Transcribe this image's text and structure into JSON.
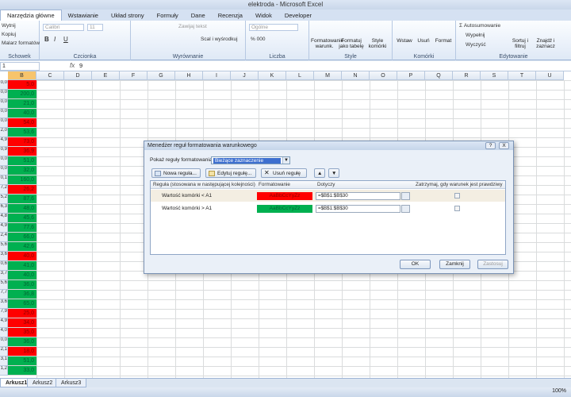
{
  "window": {
    "title": "elektroda - Microsoft Excel"
  },
  "ribbon_tabs": [
    "Narzędzia główne",
    "Wstawianie",
    "Układ strony",
    "Formuły",
    "Dane",
    "Recenzja",
    "Widok",
    "Developer"
  ],
  "ribbon": {
    "clipboard": {
      "items": [
        "Wytnij",
        "Kopiuj",
        "Malarz formatów"
      ],
      "label": "Schowek"
    },
    "font": {
      "name": "Calibri",
      "size": "11",
      "label": "Czcionka"
    },
    "alignment": {
      "wrap": "Zawijaj tekst",
      "merge": "Scal i wyśrodkuj",
      "label": "Wyrównanie"
    },
    "number": {
      "format": "Ogólne",
      "label": "Liczba"
    },
    "styles": {
      "cond": "Formatowanie warunk.",
      "table": "Formatuj jako tabelę",
      "cell": "Style komórki",
      "label": "Style"
    },
    "cells": {
      "insert": "Wstaw",
      "delete": "Usuń",
      "format": "Format",
      "label": "Komórki"
    },
    "editing": {
      "autosum": "Autosumowanie",
      "fill": "Wypełnij",
      "clear": "Wyczyść",
      "sort": "Sortuj i filtruj",
      "find": "Znajdź i zaznacz",
      "label": "Edytowanie"
    }
  },
  "formula_bar": {
    "name_box": "1",
    "fx": "fx",
    "value": "9"
  },
  "columns": [
    "B",
    "C",
    "D",
    "E",
    "F",
    "G",
    "H",
    "I",
    "J",
    "K",
    "L",
    "M",
    "N",
    "O",
    "P",
    "Q",
    "R",
    "S",
    "T",
    "U"
  ],
  "rows": [
    {
      "r": "0,0",
      "v": "5,0",
      "c": "red"
    },
    {
      "r": "0,0",
      "v": "200,0",
      "c": "green"
    },
    {
      "r": "0,0",
      "v": "21,0",
      "c": "green"
    },
    {
      "r": "0,0",
      "v": "40,0",
      "c": "green"
    },
    {
      "r": "0,0",
      "v": "54,0",
      "c": "red"
    },
    {
      "r": "2,0",
      "v": "53,6",
      "c": "green"
    },
    {
      "r": "4,9",
      "v": "73,0",
      "c": "red"
    },
    {
      "r": "0,9",
      "v": "36,9",
      "c": "red"
    },
    {
      "r": "0,0",
      "v": "51,0",
      "c": "green"
    },
    {
      "r": "0,0",
      "v": "32,0",
      "c": "green"
    },
    {
      "r": "0,1",
      "v": "160,0",
      "c": "green"
    },
    {
      "r": "7,2",
      "v": "26,2",
      "c": "red"
    },
    {
      "r": "5,2",
      "v": "87,6",
      "c": "green"
    },
    {
      "r": "6,3",
      "v": "48,0",
      "c": "green"
    },
    {
      "r": "4,8",
      "v": "45,6",
      "c": "green"
    },
    {
      "r": "4,9",
      "v": "77,6",
      "c": "green"
    },
    {
      "r": "2,4",
      "v": "66,0",
      "c": "green"
    },
    {
      "r": "5,6",
      "v": "42,6",
      "c": "green"
    },
    {
      "r": "3,6",
      "v": "40,0",
      "c": "red"
    },
    {
      "r": "0,6",
      "v": "41,0",
      "c": "green"
    },
    {
      "r": "3,7",
      "v": "40,0",
      "c": "green"
    },
    {
      "r": "5,6",
      "v": "36,0",
      "c": "green"
    },
    {
      "r": "7,7",
      "v": "36,8",
      "c": "green"
    },
    {
      "r": "3,6",
      "v": "65,0",
      "c": "green"
    },
    {
      "r": "7,9",
      "v": "25,0",
      "c": "red"
    },
    {
      "r": "4,9",
      "v": "34,0",
      "c": "red"
    },
    {
      "r": "4,0",
      "v": "35,0",
      "c": "red"
    },
    {
      "r": "0,0",
      "v": "36,0",
      "c": "green"
    },
    {
      "r": "2,1",
      "v": "18,0",
      "c": "red"
    },
    {
      "r": "3,1",
      "v": "51,0",
      "c": "green"
    },
    {
      "r": "1,2",
      "v": "33,0",
      "c": "green"
    }
  ],
  "sheet_tabs": [
    "Arkusz1",
    "Arkusz2",
    "Arkusz3"
  ],
  "status": {
    "zoom": "100%"
  },
  "dialog": {
    "title": "Menedżer reguł formatowania warunkowego",
    "help": "?",
    "close": "X",
    "show_rules_label": "Pokaż reguły formatowania dla:",
    "show_rules_value": "Bieżące zaznaczenie",
    "new_rule": "Nowa reguła...",
    "edit_rule": "Edytuj regułę...",
    "delete_rule": "Usuń regułę",
    "col_rule": "Reguła (stosowana w następującej kolejności)",
    "col_format": "Formatowanie",
    "col_applies": "Dotyczy",
    "col_stop": "Zatrzymaj, gdy warunek jest prawdziwy",
    "rules": [
      {
        "rule": "Wartość komórki < A1",
        "preview": "AaBbCcYyZz",
        "applies": "=$B$1:$B$30",
        "color": "#ff0000"
      },
      {
        "rule": "Wartość komórki > A1",
        "preview": "AaBbCcYyZz",
        "applies": "=$B$1:$B$30",
        "color": "#00b050"
      }
    ],
    "ok": "OK",
    "cancel": "Zamknij",
    "apply": "Zastosuj"
  }
}
